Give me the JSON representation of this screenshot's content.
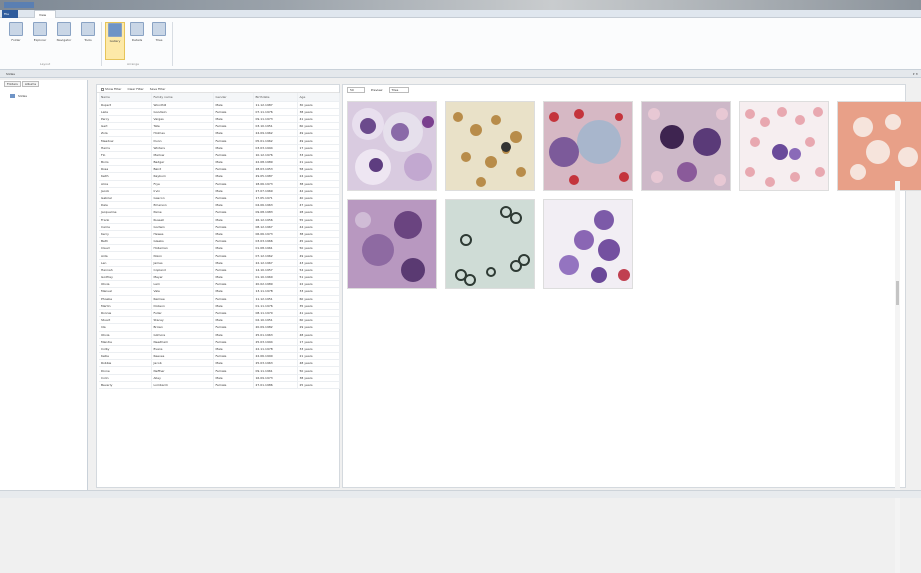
{
  "ribbon": {
    "tabs": [
      "File",
      "View"
    ],
    "buttons": [
      "Folder",
      "Explorer",
      "Navigator",
      "Tools",
      "Gallery",
      "Details",
      "Tiles"
    ],
    "groups": [
      "Layout",
      "Arrange"
    ]
  },
  "pane": {
    "title": "Slides",
    "pin": "▾ ✕"
  },
  "left": {
    "tabs": [
      "Folders",
      "Albums"
    ],
    "node": "Slides"
  },
  "filters": {
    "show": "Show Filter",
    "clear": "Clear Filter",
    "save": "Save Filter"
  },
  "columns": [
    "Name",
    "Family name",
    "Gender",
    "Birthdate",
    "Age"
  ],
  "rows": [
    [
      "Rupert",
      "Woodhill",
      "Male",
      "11.12.1987",
      "30 years"
    ],
    [
      "Laila",
      "Goodwin",
      "Female",
      "07.11.1976",
      "38 years"
    ],
    [
      "Percy",
      "Vargas",
      "Male",
      "09.11.1973",
      "41 years"
    ],
    [
      "Gert",
      "Tate",
      "Female",
      "03.10.1951",
      "60 years"
    ],
    [
      "Zola",
      "Holmes",
      "Male",
      "24.09.1962",
      "49 years"
    ],
    [
      "Meadow",
      "Dunn",
      "Female",
      "05.01.1962",
      "49 years"
    ],
    [
      "Harris",
      "Winters",
      "Male",
      "03.03.1994",
      "17 years"
    ],
    [
      "Flo",
      "Marlow",
      "Female",
      "10.12.1976",
      "33 years"
    ],
    [
      "Boris",
      "Badger",
      "Male",
      "22.08.1989",
      "21 years"
    ],
    [
      "Rosa",
      "Baird",
      "Female",
      "28.03.1953",
      "58 years"
    ],
    [
      "Keith",
      "Rayburn",
      "Male",
      "29.05.1987",
      "24 years"
    ],
    [
      "Alice",
      "Frye",
      "Female",
      "18.06.1973",
      "38 years"
    ],
    [
      "Jacob",
      "Irvin",
      "Male",
      "27.07.1969",
      "42 years"
    ],
    [
      "Gabriel",
      "Gascon",
      "Female",
      "17.05.1971",
      "40 years"
    ],
    [
      "Dale",
      "Emerson",
      "Male",
      "04.06.1963",
      "47 years"
    ],
    [
      "Jacqueline",
      "Paine",
      "Female",
      "09.08.1983",
      "28 years"
    ],
    [
      "Frank",
      "Russell",
      "Male",
      "26.12.1956",
      "55 years"
    ],
    [
      "Carrie",
      "Godwin",
      "Female",
      "08.12.1967",
      "44 years"
    ],
    [
      "Kerry",
      "Hewes",
      "Male",
      "06.06.1973",
      "38 years"
    ],
    [
      "Beth",
      "Gleeks",
      "Female",
      "03.03.1966",
      "45 years"
    ],
    [
      "Claud",
      "Holleman",
      "Male",
      "01.08.1961",
      "50 years"
    ],
    [
      "Aida",
      "Nixon",
      "Female",
      "07.12.1962",
      "49 years"
    ],
    [
      "Len",
      "James",
      "Male",
      "22.12.1967",
      "43 years"
    ],
    [
      "Hannah",
      "Copland",
      "Female",
      "14.10.1957",
      "54 years"
    ],
    [
      "Godfrey",
      "Meyer",
      "Male",
      "01.10.1960",
      "51 years"
    ],
    [
      "Olivia",
      "Lam",
      "Female",
      "20.02.1989",
      "22 years"
    ],
    [
      "Manuel",
      "Vale",
      "Male",
      "13.11.1978",
      "33 years"
    ],
    [
      "Phoebe",
      "Remiee",
      "Female",
      "11.12.1951",
      "60 years"
    ],
    [
      "Martin",
      "Dobson",
      "Male",
      "01.11.1976",
      "35 years"
    ],
    [
      "Ronnie",
      "Fuller",
      "Female",
      "08.11.1970",
      "41 years"
    ],
    [
      "Stuart",
      "Stacey",
      "Male",
      "02.10.1951",
      "60 years"
    ],
    [
      "Ida",
      "Brown",
      "Female",
      "20.09.1982",
      "29 years"
    ],
    [
      "Olivia",
      "Gilmore",
      "Male",
      "25.01.1963",
      "48 years"
    ],
    [
      "Mandie",
      "Needham",
      "Female",
      "25.03.1994",
      "17 years"
    ],
    [
      "Colby",
      "Evans",
      "Male",
      "22.11.1978",
      "33 years"
    ],
    [
      "Kellie",
      "Reeves",
      "Female",
      "22.06.1990",
      "21 years"
    ],
    [
      "Robbie",
      "Jacob",
      "Male",
      "25.03.1963",
      "48 years"
    ],
    [
      "Dione",
      "Neffner",
      "Female",
      "09.11.1961",
      "50 years"
    ],
    [
      "Colin",
      "Alley",
      "Male",
      "16.09.1973",
      "38 years"
    ],
    [
      "Beverly",
      "Lombardi",
      "Female",
      "27.01.1986",
      "25 years"
    ]
  ],
  "viewer": {
    "zoom": "50",
    "preview": "Preview",
    "view": "Tiles"
  }
}
